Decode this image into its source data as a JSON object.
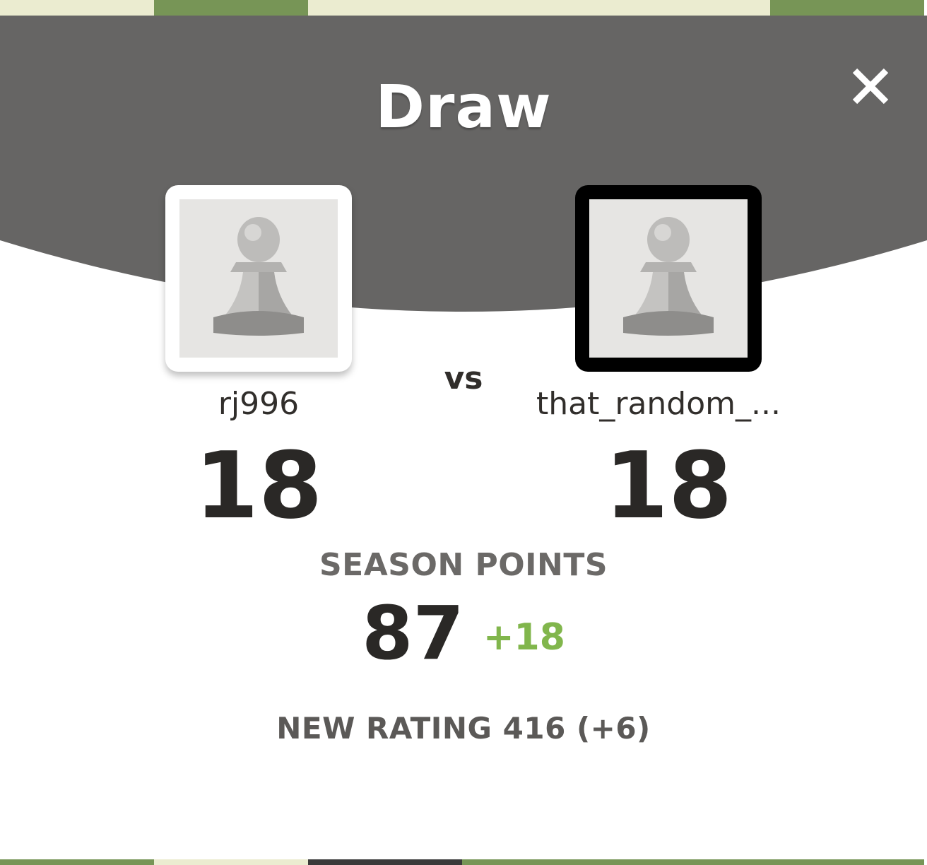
{
  "modal": {
    "title": "Draw",
    "close_icon": "close-icon",
    "header_color": "#666564",
    "vs_label": "vs"
  },
  "players": {
    "left": {
      "username": "rj996",
      "score": "18",
      "avatar_icon": "pawn-icon",
      "frame_color": "#ffffff"
    },
    "right": {
      "username": "that_random_...",
      "score": "18",
      "avatar_icon": "pawn-icon",
      "frame_color": "#000000"
    }
  },
  "season": {
    "label": "SEASON POINTS",
    "value": "87",
    "delta": "+18",
    "delta_color": "#81b64c"
  },
  "rating": {
    "text": "NEW RATING 416 (+6)"
  }
}
